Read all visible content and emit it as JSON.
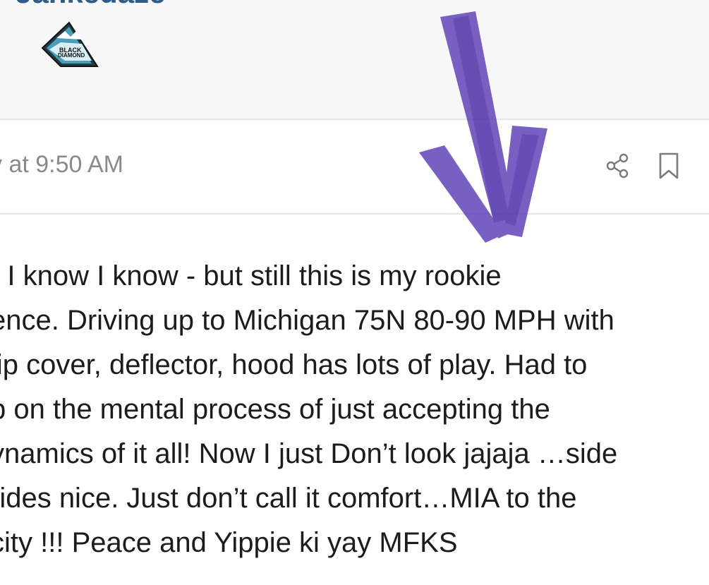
{
  "header": {
    "username_fragment": "Jankedaze",
    "badge": {
      "icon": "black-diamond-logo",
      "text_line1": "BLACK",
      "text_line2": "DIAMOND"
    }
  },
  "post_meta": {
    "timestamp": "y at 9:50 AM",
    "actions": {
      "share_icon": "share-icon",
      "bookmark_icon": "bookmark-icon"
    }
  },
  "post": {
    "lines": [
      "r I know I know - but still this is my rookie",
      "ence. Driving up to Michigan 75N 80-90 MPH with",
      " lip cover, deflector, hood has lots of play. Had to",
      "p on the mental process of just accepting the",
      "ynamics of it all! Now I just Don’t look jajaja …side",
      "rides nice. Just don’t call it comfort…MIA to the",
      "city !!! Peace and Yippie ki yay MFKS"
    ]
  },
  "annotation": {
    "icon": "down-arrow-annotation",
    "color": "#5b3db5"
  },
  "colors": {
    "username": "#2c5c87",
    "timestamp": "#8a8a8a",
    "body_text": "#1c1c1c",
    "icon_gray": "#7a7a7a",
    "header_bg": "#f7f7f7"
  }
}
